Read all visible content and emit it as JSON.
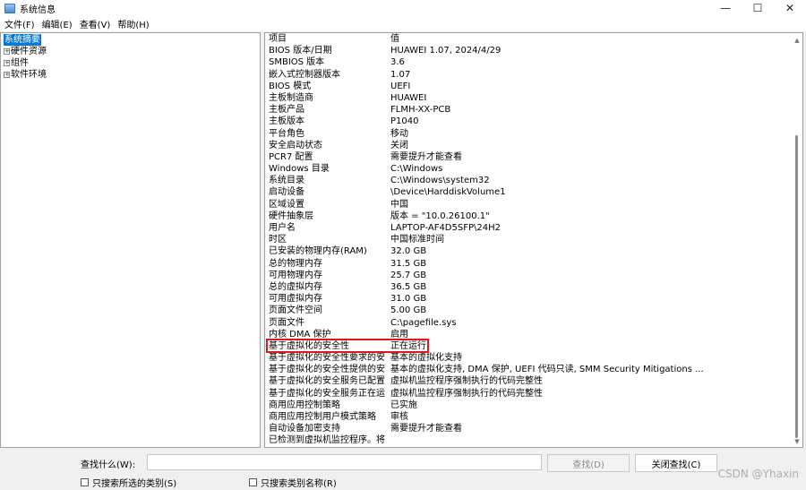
{
  "window": {
    "title": "系统信息",
    "controls": {
      "minimize": "—",
      "maximize": "☐",
      "close": "✕"
    }
  },
  "menubar": [
    "文件(F)",
    "编辑(E)",
    "查看(V)",
    "帮助(H)"
  ],
  "tree": {
    "root": "系统摘要",
    "children": [
      "硬件资源",
      "组件",
      "软件环境"
    ],
    "expander_symbol": "+"
  },
  "list": {
    "header": {
      "item": "项目",
      "value": "值"
    },
    "rows": [
      {
        "item": "BIOS 版本/日期",
        "value": "HUAWEI 1.07, 2024/4/29"
      },
      {
        "item": "SMBIOS 版本",
        "value": "3.6"
      },
      {
        "item": "嵌入式控制器版本",
        "value": "1.07"
      },
      {
        "item": "BIOS 模式",
        "value": "UEFI"
      },
      {
        "item": "主板制造商",
        "value": "HUAWEI"
      },
      {
        "item": "主板产品",
        "value": "FLMH-XX-PCB"
      },
      {
        "item": "主板版本",
        "value": "P1040"
      },
      {
        "item": "平台角色",
        "value": "移动"
      },
      {
        "item": "安全启动状态",
        "value": "关闭"
      },
      {
        "item": "PCR7 配置",
        "value": "需要提升才能查看"
      },
      {
        "item": "Windows 目录",
        "value": "C:\\Windows"
      },
      {
        "item": "系统目录",
        "value": "C:\\Windows\\system32"
      },
      {
        "item": "启动设备",
        "value": "\\Device\\HarddiskVolume1"
      },
      {
        "item": "区域设置",
        "value": "中国"
      },
      {
        "item": "硬件抽象层",
        "value": "版本 = \"10.0.26100.1\""
      },
      {
        "item": "用户名",
        "value": "LAPTOP-AF4D5SFP\\24H2"
      },
      {
        "item": "时区",
        "value": "中国标准时间"
      },
      {
        "item": "已安装的物理内存(RAM)",
        "value": "32.0 GB"
      },
      {
        "item": "总的物理内存",
        "value": "31.5 GB"
      },
      {
        "item": "可用物理内存",
        "value": "25.7 GB"
      },
      {
        "item": "总的虚拟内存",
        "value": "36.5 GB"
      },
      {
        "item": "可用虚拟内存",
        "value": "31.0 GB"
      },
      {
        "item": "页面文件空间",
        "value": "5.00 GB"
      },
      {
        "item": "页面文件",
        "value": "C:\\pagefile.sys"
      },
      {
        "item": "内核 DMA 保护",
        "value": "启用"
      },
      {
        "item": "基于虚拟化的安全性",
        "value": "正在运行"
      },
      {
        "item": "基于虚拟化的安全性要求的安...",
        "value": "基本的虚拟化支持"
      },
      {
        "item": "基于虚拟化的安全性提供的安...",
        "value": "基本的虚拟化支持, DMA 保护, UEFI 代码只读, SMM Security Mitigations ..."
      },
      {
        "item": "基于虚拟化的安全服务已配置",
        "value": "虚拟机监控程序强制执行的代码完整性"
      },
      {
        "item": "基于虚拟化的安全服务正在运行",
        "value": "虚拟机监控程序强制执行的代码完整性"
      },
      {
        "item": "商用应用控制策略",
        "value": "已实施"
      },
      {
        "item": "商用应用控制用户模式策略",
        "value": "审核"
      },
      {
        "item": "自动设备加密支持",
        "value": "需要提升才能查看"
      },
      {
        "item": "已检测到虚拟机监控程序。将...",
        "value": ""
      }
    ]
  },
  "findbar": {
    "label": "查找什么(W):",
    "input_value": "",
    "find_button": "查找(D)",
    "close_find_button": "关闭查找(C)",
    "checkbox_selected_category": "只搜索所选的类别(S)",
    "checkbox_category_names": "只搜索类别名称(R)"
  },
  "watermark": "CSDN @Yhaxin",
  "colors": {
    "selection": "#0078d7",
    "highlight_border": "#e0161c"
  }
}
